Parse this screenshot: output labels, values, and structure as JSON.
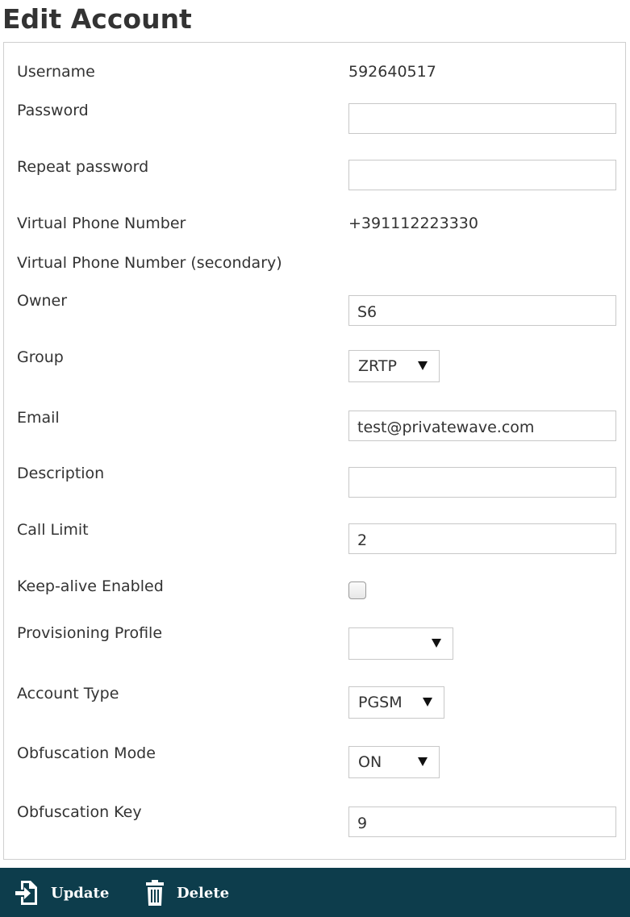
{
  "page": {
    "title": "Edit Account"
  },
  "form": {
    "username": {
      "label": "Username",
      "value": "592640517"
    },
    "password": {
      "label": "Password",
      "value": ""
    },
    "repeat_password": {
      "label": "Repeat password",
      "value": ""
    },
    "virtual_phone": {
      "label": "Virtual Phone Number",
      "value": "+391112223330"
    },
    "virtual_phone_secondary": {
      "label": "Virtual Phone Number (secondary)",
      "value": ""
    },
    "owner": {
      "label": "Owner",
      "value": "S6"
    },
    "group": {
      "label": "Group",
      "value": "ZRTP"
    },
    "email": {
      "label": "Email",
      "value": "test@privatewave.com"
    },
    "description": {
      "label": "Description",
      "value": ""
    },
    "call_limit": {
      "label": "Call Limit",
      "value": "2"
    },
    "keep_alive": {
      "label": "Keep-alive Enabled",
      "checked": false
    },
    "provisioning_profile": {
      "label": "Provisioning Profile",
      "value": ""
    },
    "account_type": {
      "label": "Account Type",
      "value": "PGSM"
    },
    "obfuscation_mode": {
      "label": "Obfuscation Mode",
      "value": "ON"
    },
    "obfuscation_key": {
      "label": "Obfuscation Key",
      "value": "9"
    }
  },
  "toolbar": {
    "update_label": "Update",
    "update_icon": "sign-in-icon",
    "delete_label": "Delete",
    "delete_icon": "trash-icon",
    "background_color": "#0d3d4c"
  }
}
